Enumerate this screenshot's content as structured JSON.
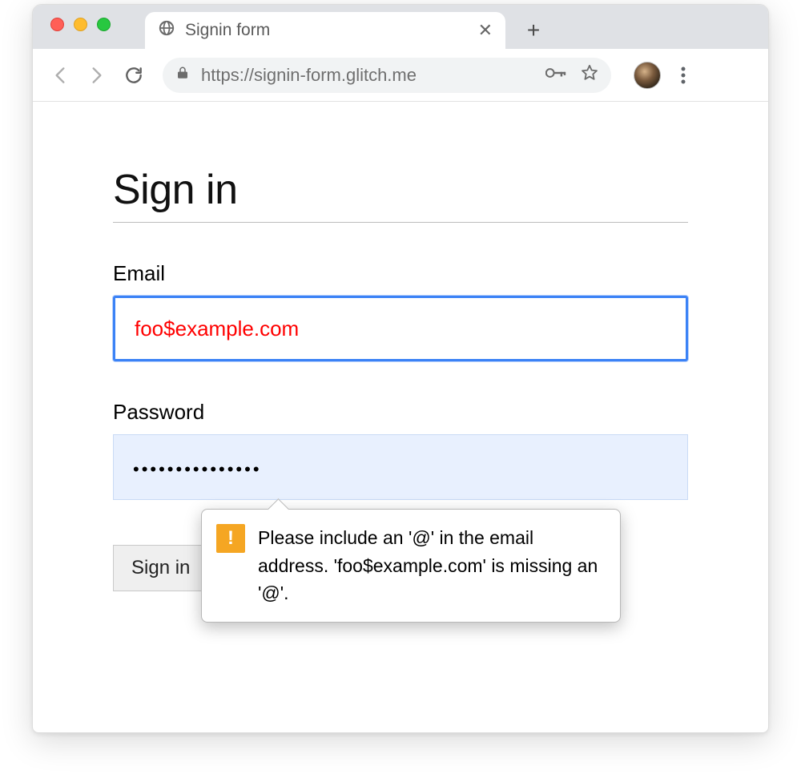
{
  "browser": {
    "tab_title": "Signin form",
    "url": "https://signin-form.glitch.me"
  },
  "page": {
    "heading": "Sign in",
    "email_label": "Email",
    "email_value": "foo$example.com",
    "password_label": "Password",
    "password_value": "•••••••••••••••",
    "submit_label": "Sign in"
  },
  "validation": {
    "message": "Please include an '@' in the email address. 'foo$example.com' is missing an '@'."
  }
}
